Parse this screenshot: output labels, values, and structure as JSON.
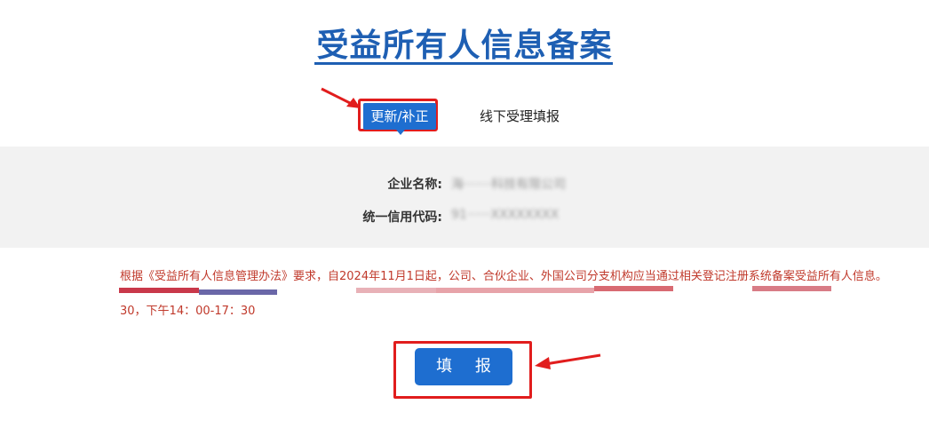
{
  "header": {
    "title": "受益所有人信息备案"
  },
  "tabs": [
    {
      "label": "更新/补正",
      "active": true
    },
    {
      "label": "线下受理填报",
      "active": false
    }
  ],
  "company_info": {
    "name_label": "企业名称:",
    "name_value": "海·······科技有限公司",
    "credit_code_label": "统一信用代码:",
    "credit_code_value": "91······XXXXXXXX"
  },
  "notice": {
    "text": "根据《受益所有人信息管理办法》要求，自2024年11月1日起，公司、合伙企业、外国公司分支机构应当通过相关登记注册系统备案受益所有人信息。",
    "time": "30，下午14：00-17：30"
  },
  "actions": {
    "fill_label": "填 报"
  },
  "colors": {
    "primary": "#1e6ed0",
    "title": "#1e5fb3",
    "highlight": "#e11d1d",
    "notice": "#c0392b"
  }
}
